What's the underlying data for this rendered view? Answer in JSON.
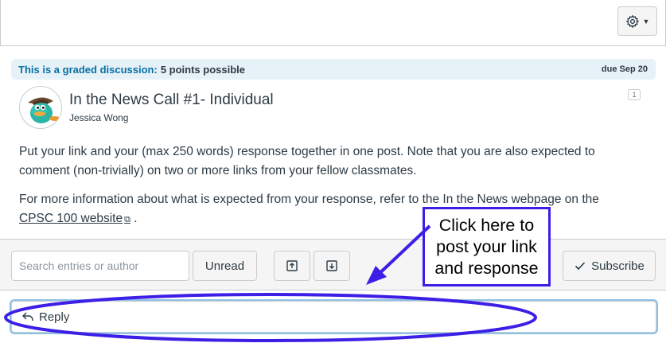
{
  "banner": {
    "graded_label": "This is a graded discussion:",
    "points": "5 points possible",
    "due": "due Sep 20"
  },
  "topic": {
    "title": "In the News Call #1- Individual",
    "author": "Jessica Wong",
    "reply_count": "1",
    "para1": "Put your link and your (max 250 words) response together in one post. Note that you are also expected to comment (non-trivially) on two or more links from your fellow classmates.",
    "para2_prefix": "For more information about what is expected from your response, refer to the In the News webpage on the",
    "link_text": "CPSC 100 website",
    "para2_suffix": " ."
  },
  "toolbar": {
    "search_placeholder": "Search entries or author",
    "unread_label": "Unread",
    "subscribe_label": "Subscribe"
  },
  "reply": {
    "label": "Reply"
  },
  "annotation": {
    "text": "Click here to post your link and response",
    "color": "#3c1fe6"
  },
  "icons": {
    "settings": "gear-icon",
    "expand": "expand-icon",
    "collapse": "collapse-icon",
    "subscribe": "checkmark-icon",
    "reply": "reply-arrow-icon",
    "external": "external-link-icon"
  }
}
